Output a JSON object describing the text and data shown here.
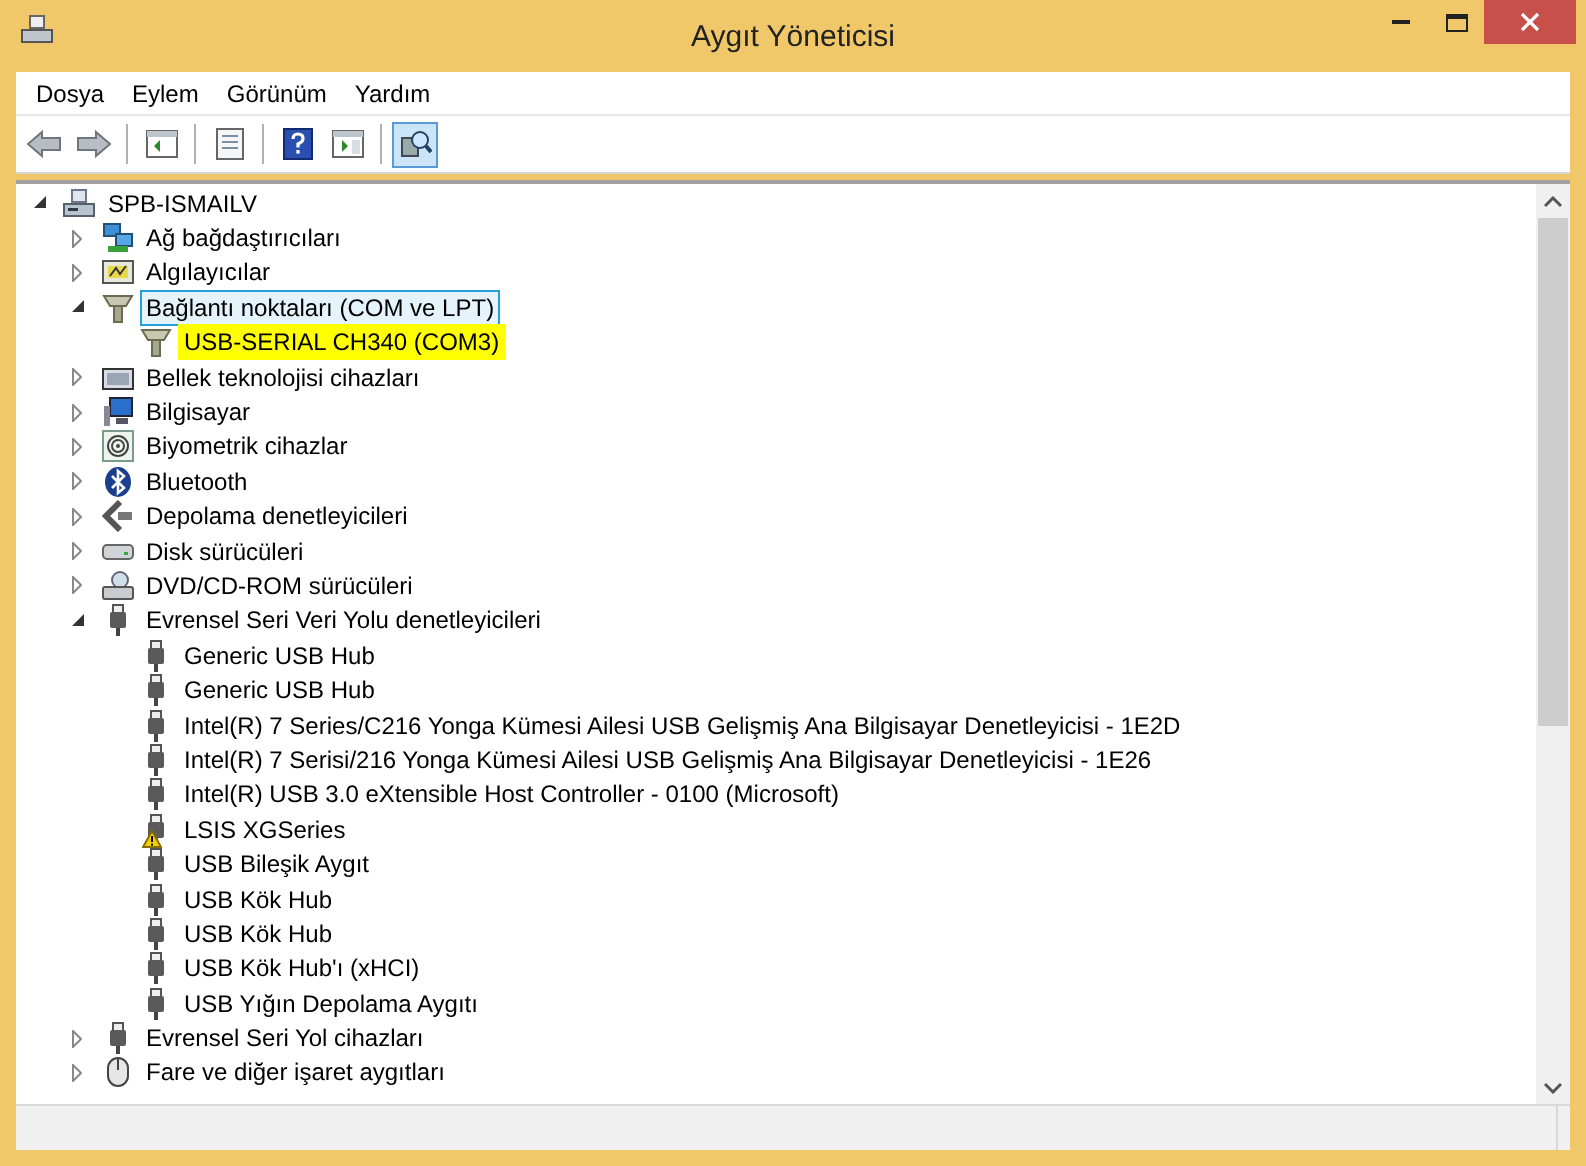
{
  "window": {
    "title": "Aygıt Yöneticisi"
  },
  "menu": [
    "Dosya",
    "Eylem",
    "Görünüm",
    "Yardım"
  ],
  "toolbar": [
    {
      "kind": "back",
      "pressed": false
    },
    {
      "kind": "forward",
      "pressed": false
    },
    {
      "kind": "separator"
    },
    {
      "kind": "console-tree",
      "pressed": false
    },
    {
      "kind": "separator"
    },
    {
      "kind": "properties",
      "pressed": false
    },
    {
      "kind": "separator"
    },
    {
      "kind": "help",
      "pressed": false
    },
    {
      "kind": "action-pane",
      "pressed": false
    },
    {
      "kind": "separator"
    },
    {
      "kind": "scan",
      "pressed": true
    }
  ],
  "tree": {
    "label": "SPB-ISMAILV",
    "kind": "root",
    "expanded": true,
    "selected": false,
    "highlighted": false,
    "children": [
      {
        "label": "Ağ bağdaştırıcıları",
        "kind": "network",
        "expanded": false,
        "selected": false,
        "highlighted": false
      },
      {
        "label": "Algılayıcılar",
        "kind": "sensor",
        "expanded": false,
        "selected": false,
        "highlighted": false
      },
      {
        "label": "Bağlantı noktaları (COM ve LPT)",
        "kind": "port",
        "expanded": true,
        "selected": true,
        "highlighted": false,
        "children": [
          {
            "label": "USB-SERIAL CH340 (COM3)",
            "kind": "port",
            "selected": false,
            "highlighted": true
          }
        ]
      },
      {
        "label": "Bellek teknolojisi cihazları",
        "kind": "memory",
        "expanded": false,
        "selected": false,
        "highlighted": false
      },
      {
        "label": "Bilgisayar",
        "kind": "computer",
        "expanded": false,
        "selected": false,
        "highlighted": false
      },
      {
        "label": "Biyometrik cihazlar",
        "kind": "biometric",
        "expanded": false,
        "selected": false,
        "highlighted": false
      },
      {
        "label": "Bluetooth",
        "kind": "bluetooth",
        "expanded": false,
        "selected": false,
        "highlighted": false
      },
      {
        "label": "Depolama denetleyicileri",
        "kind": "storage",
        "expanded": false,
        "selected": false,
        "highlighted": false
      },
      {
        "label": "Disk sürücüleri",
        "kind": "disk",
        "expanded": false,
        "selected": false,
        "highlighted": false
      },
      {
        "label": "DVD/CD-ROM sürücüleri",
        "kind": "dvd",
        "expanded": false,
        "selected": false,
        "highlighted": false
      },
      {
        "label": "Evrensel Seri Veri Yolu denetleyicileri",
        "kind": "usb",
        "expanded": true,
        "selected": false,
        "highlighted": false,
        "children": [
          {
            "label": "Generic USB Hub",
            "kind": "usb",
            "warning": false,
            "selected": false,
            "highlighted": false
          },
          {
            "label": "Generic USB Hub",
            "kind": "usb",
            "warning": false,
            "selected": false,
            "highlighted": false
          },
          {
            "label": "Intel(R) 7 Series/C216 Yonga Kümesi Ailesi USB Gelişmiş Ana Bilgisayar Denetleyicisi - 1E2D",
            "kind": "usb",
            "warning": false,
            "selected": false,
            "highlighted": false
          },
          {
            "label": "Intel(R) 7 Serisi/216 Yonga Kümesi Ailesi USB Gelişmiş Ana Bilgisayar Denetleyicisi - 1E26",
            "kind": "usb",
            "warning": false,
            "selected": false,
            "highlighted": false
          },
          {
            "label": "Intel(R) USB 3.0 eXtensible Host Controller - 0100 (Microsoft)",
            "kind": "usb",
            "warning": false,
            "selected": false,
            "highlighted": false
          },
          {
            "label": "LSIS XGSeries",
            "kind": "usb",
            "warning": true,
            "selected": false,
            "highlighted": false
          },
          {
            "label": "USB Bileşik Aygıt",
            "kind": "usb",
            "warning": false,
            "selected": false,
            "highlighted": false
          },
          {
            "label": "USB Kök Hub",
            "kind": "usb",
            "warning": false,
            "selected": false,
            "highlighted": false
          },
          {
            "label": "USB Kök Hub",
            "kind": "usb",
            "warning": false,
            "selected": false,
            "highlighted": false
          },
          {
            "label": "USB Kök Hub'ı (xHCI)",
            "kind": "usb",
            "warning": false,
            "selected": false,
            "highlighted": false
          },
          {
            "label": "USB Yığın Depolama Aygıtı",
            "kind": "usb",
            "warning": false,
            "selected": false,
            "highlighted": false
          }
        ]
      },
      {
        "label": "Evrensel Seri Yol cihazları",
        "kind": "usb",
        "expanded": false,
        "selected": false,
        "highlighted": false
      },
      {
        "label": "Fare ve diğer işaret aygıtları",
        "kind": "mouse",
        "expanded": false,
        "selected": false,
        "highlighted": false
      }
    ]
  }
}
